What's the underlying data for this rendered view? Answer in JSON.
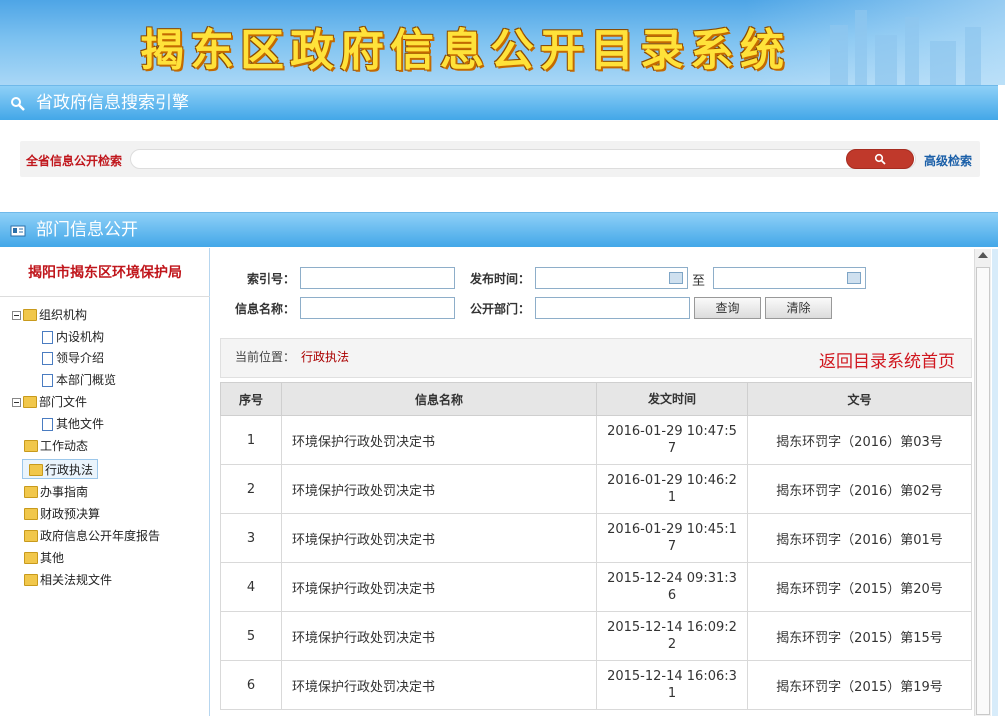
{
  "banner": {
    "title": "揭东区政府信息公开目录系统"
  },
  "province_search": {
    "header": "省政府信息搜索引擎",
    "label": "全省信息公开检索",
    "placeholder": "",
    "button_icon": "search-icon",
    "advanced": "高级检索"
  },
  "dept": {
    "header": "部门信息公开",
    "org_name": "揭阳市揭东区环境保护局"
  },
  "tree": [
    {
      "label": "组织机构",
      "type": "folder-open"
    },
    {
      "label": "内设机构",
      "type": "doc"
    },
    {
      "label": "领导介绍",
      "type": "doc"
    },
    {
      "label": "本部门概览",
      "type": "doc"
    },
    {
      "label": "部门文件",
      "type": "folder-open"
    },
    {
      "label": "其他文件",
      "type": "doc"
    },
    {
      "label": "工作动态",
      "type": "folder"
    },
    {
      "label": "行政执法",
      "type": "folder",
      "selected": true
    },
    {
      "label": "办事指南",
      "type": "folder"
    },
    {
      "label": "财政预决算",
      "type": "folder"
    },
    {
      "label": "政府信息公开年度报告",
      "type": "folder"
    },
    {
      "label": "其他",
      "type": "folder"
    },
    {
      "label": "相关法规文件",
      "type": "folder"
    }
  ],
  "form": {
    "index_label": "索引号：",
    "index_value": "",
    "date_label": "发布时间：",
    "date_from": "",
    "date_to_label": "至",
    "date_to": "",
    "name_label": "信息名称：",
    "name_value": "",
    "dept_label": "公开部门：",
    "dept_value": "",
    "query_btn": "查询",
    "clear_btn": "清除"
  },
  "location": {
    "label": "当前位置：",
    "value": "行政执法",
    "home_link": "返回目录系统首页"
  },
  "table": {
    "headers": [
      "序号",
      "信息名称",
      "发文时间",
      "文号"
    ],
    "rows": [
      {
        "no": "1",
        "name": "环境保护行政处罚决定书",
        "time": "2016-01-29 10:47:57",
        "doc_no": "揭东环罚字（2016）第03号"
      },
      {
        "no": "2",
        "name": "环境保护行政处罚决定书",
        "time": "2016-01-29 10:46:21",
        "doc_no": "揭东环罚字（2016）第02号"
      },
      {
        "no": "3",
        "name": "环境保护行政处罚决定书",
        "time": "2016-01-29 10:45:17",
        "doc_no": "揭东环罚字（2016）第01号"
      },
      {
        "no": "4",
        "name": "环境保护行政处罚决定书",
        "time": "2015-12-24 09:31:36",
        "doc_no": "揭东环罚字（2015）第20号"
      },
      {
        "no": "5",
        "name": "环境保护行政处罚决定书",
        "time": "2015-12-14 16:09:22",
        "doc_no": "揭东环罚字（2015）第15号"
      },
      {
        "no": "6",
        "name": "环境保护行政处罚决定书",
        "time": "2015-12-14 16:06:31",
        "doc_no": "揭东环罚字（2015）第19号"
      }
    ]
  }
}
